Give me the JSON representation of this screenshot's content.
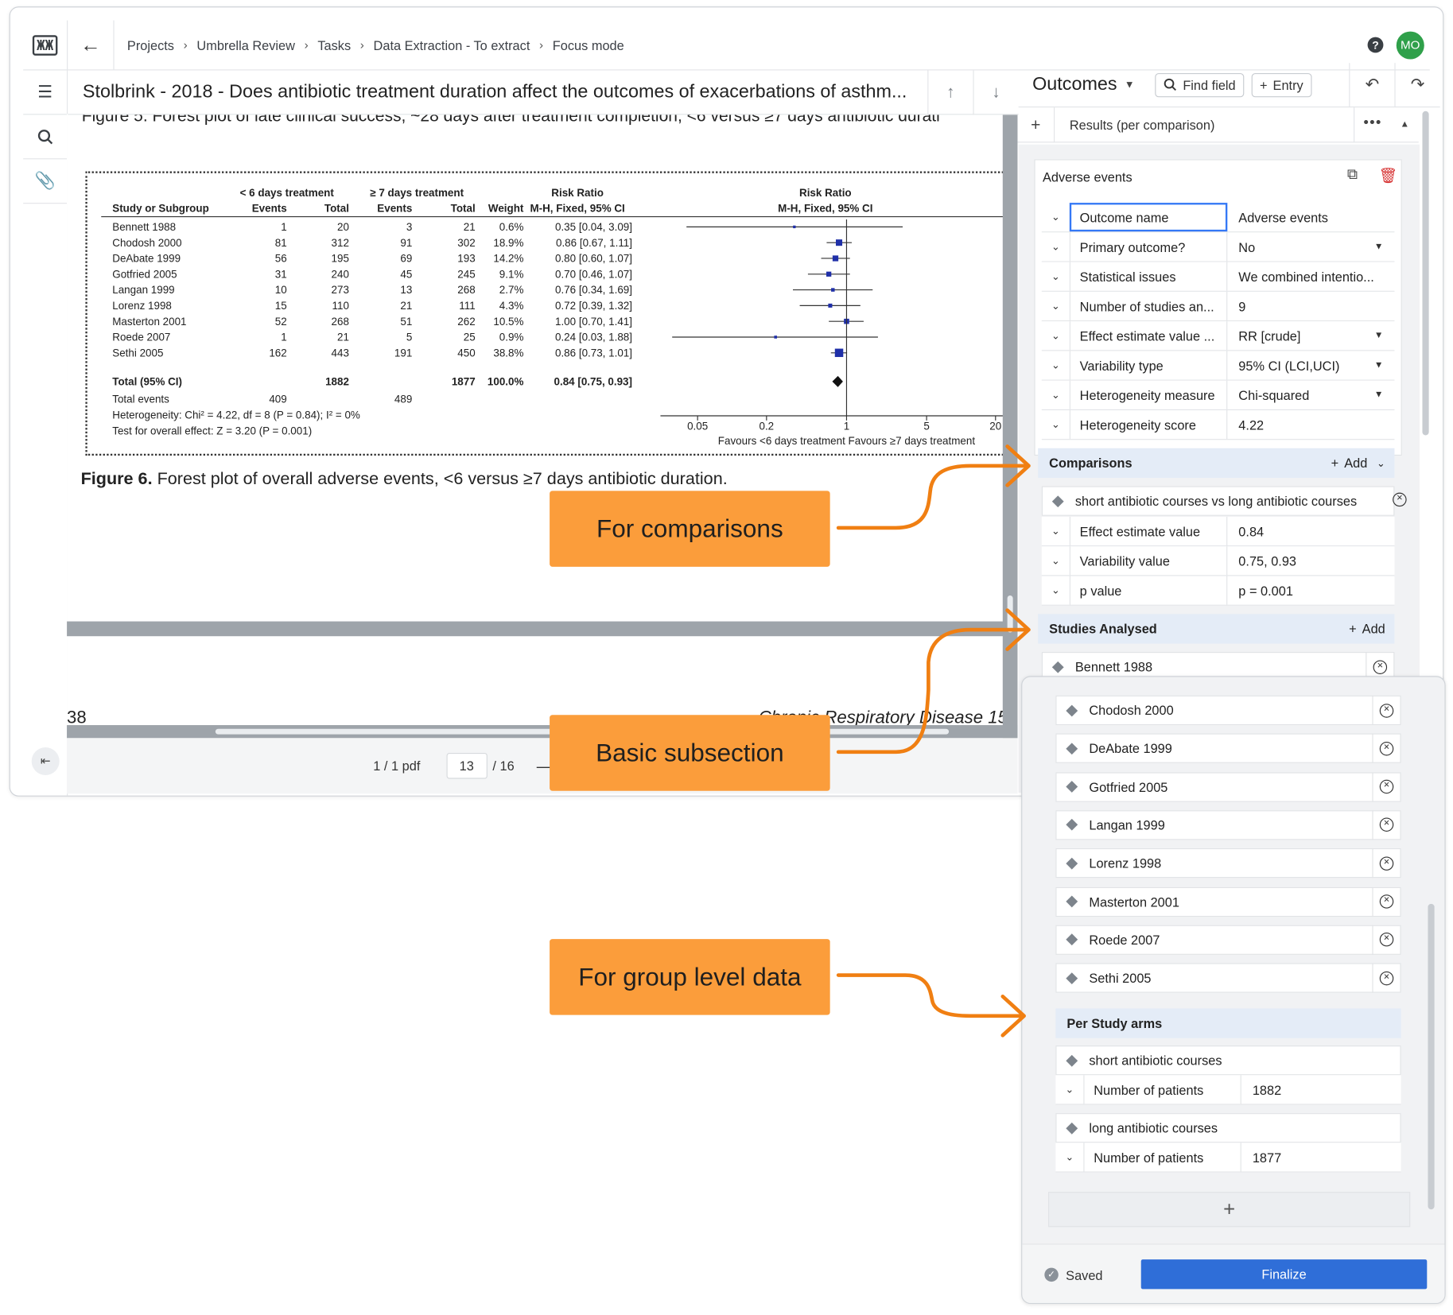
{
  "app": {
    "logo_text": "ЖЖ",
    "breadcrumb": [
      "Projects",
      "Umbrella Review",
      "Tasks",
      "Data Extraction - To extract",
      "Focus mode"
    ],
    "user_initials": "MO",
    "accent_color": "#2fa04a"
  },
  "document": {
    "title": "Stolbrink - 2018 - Does antibiotic treatment duration affect the outcomes of exacerbations of asthm...",
    "cut_line": "Figure 5. Forest plot of late clinical success, ~28 days after treatment completion, <6 versus ≥7 days antibiotic durati",
    "caption_bold": "Figure 6.",
    "caption_text": " Forest plot of overall adverse events, <6 versus ≥7 days antibiotic duration.",
    "page_number": "38",
    "journal": "Chronic Respiratory Disease 15(",
    "pdf_count": "1 / 1 pdf",
    "current_page": "13",
    "total_pages": "/ 16"
  },
  "chart_data": {
    "type": "table",
    "group_headers": [
      "< 6 days treatment",
      "≥ 7 days treatment",
      "Risk Ratio",
      "Risk Ratio"
    ],
    "columns": [
      "Study or Subgroup",
      "Events",
      "Total",
      "Events",
      "Total",
      "Weight",
      "M-H, Fixed, 95% CI",
      "M-H, Fixed, 95% CI"
    ],
    "rows": [
      {
        "study": "Bennett 1988",
        "e1": "1",
        "t1": "20",
        "e2": "3",
        "t2": "21",
        "weight": "0.6%",
        "ci": "0.35 [0.04, 3.09]",
        "rr": 0.35,
        "lo": 0.04,
        "hi": 3.09
      },
      {
        "study": "Chodosh 2000",
        "e1": "81",
        "t1": "312",
        "e2": "91",
        "t2": "302",
        "weight": "18.9%",
        "ci": "0.86 [0.67, 1.11]",
        "rr": 0.86,
        "lo": 0.67,
        "hi": 1.11
      },
      {
        "study": "DeAbate 1999",
        "e1": "56",
        "t1": "195",
        "e2": "69",
        "t2": "193",
        "weight": "14.2%",
        "ci": "0.80 [0.60, 1.07]",
        "rr": 0.8,
        "lo": 0.6,
        "hi": 1.07
      },
      {
        "study": "Gotfried 2005",
        "e1": "31",
        "t1": "240",
        "e2": "45",
        "t2": "245",
        "weight": "9.1%",
        "ci": "0.70 [0.46, 1.07]",
        "rr": 0.7,
        "lo": 0.46,
        "hi": 1.07
      },
      {
        "study": "Langan 1999",
        "e1": "10",
        "t1": "273",
        "e2": "13",
        "t2": "268",
        "weight": "2.7%",
        "ci": "0.76 [0.34, 1.69]",
        "rr": 0.76,
        "lo": 0.34,
        "hi": 1.69
      },
      {
        "study": "Lorenz 1998",
        "e1": "15",
        "t1": "110",
        "e2": "21",
        "t2": "111",
        "weight": "4.3%",
        "ci": "0.72 [0.39, 1.32]",
        "rr": 0.72,
        "lo": 0.39,
        "hi": 1.32
      },
      {
        "study": "Masterton 2001",
        "e1": "52",
        "t1": "268",
        "e2": "51",
        "t2": "262",
        "weight": "10.5%",
        "ci": "1.00 [0.70, 1.41]",
        "rr": 1.0,
        "lo": 0.7,
        "hi": 1.41
      },
      {
        "study": "Roede 2007",
        "e1": "1",
        "t1": "21",
        "e2": "5",
        "t2": "25",
        "weight": "0.9%",
        "ci": "0.24 [0.03, 1.88]",
        "rr": 0.24,
        "lo": 0.03,
        "hi": 1.88
      },
      {
        "study": "Sethi 2005",
        "e1": "162",
        "t1": "443",
        "e2": "191",
        "t2": "450",
        "weight": "38.8%",
        "ci": "0.86 [0.73, 1.01]",
        "rr": 0.86,
        "lo": 0.73,
        "hi": 1.01
      }
    ],
    "total_row": {
      "study": "Total (95% CI)",
      "t1": "1882",
      "t2": "1877",
      "weight": "100.0%",
      "ci": "0.84 [0.75, 0.93]",
      "rr": 0.84,
      "lo": 0.75,
      "hi": 0.93
    },
    "events_row": {
      "study": "Total events",
      "e1": "409",
      "e2": "489"
    },
    "heterogeneity": "Heterogeneity: Chi² = 4.22, df = 8 (P = 0.84); I² = 0%",
    "overall_effect": "Test for overall effect: Z = 3.20 (P = 0.001)",
    "x_ticks": [
      "0.05",
      "0.2",
      "1",
      "5",
      "20"
    ],
    "x_tick_values": [
      0.05,
      0.2,
      1,
      5,
      20
    ],
    "xlim": [
      0.03,
      30
    ],
    "x_scale": "log",
    "favours": "Favours <6 days treatment  Favours ≥7 days treatment",
    "marker_color": "#1f2fa8"
  },
  "fields_panel": {
    "header": "Outcomes",
    "find_field": "Find field",
    "entry": "Entry",
    "results_label": "Results (per comparison)",
    "card_title": "Adverse events",
    "fields": [
      {
        "name": "Outcome name",
        "value": "Adverse events",
        "dropdown": false
      },
      {
        "name": "Primary outcome?",
        "value": "No",
        "dropdown": true
      },
      {
        "name": "Statistical issues",
        "value": "We combined intentio...",
        "dropdown": false
      },
      {
        "name": "Number of studies an...",
        "value": "9",
        "dropdown": false
      },
      {
        "name": "Effect estimate value ...",
        "value": "RR [crude]",
        "dropdown": true
      },
      {
        "name": "Variability type",
        "value": "95% CI (LCI,UCI)",
        "dropdown": true
      },
      {
        "name": "Heterogeneity measure",
        "value": "Chi-squared",
        "dropdown": true
      },
      {
        "name": "Heterogeneity score",
        "value": "4.22",
        "dropdown": false
      }
    ],
    "comparisons": {
      "title": "Comparisons",
      "add": "Add",
      "item": "short antibiotic courses vs long antibiotic courses",
      "fields": [
        {
          "name": "Effect estimate value",
          "value": "0.84"
        },
        {
          "name": "Variability value",
          "value": "0.75, 0.93"
        },
        {
          "name": "p value",
          "value": "p = 0.001"
        }
      ]
    },
    "studies": {
      "title": "Studies Analysed",
      "add": "Add",
      "first": "Bennett 1988"
    }
  },
  "float_panel": {
    "studies": [
      "Chodosh 2000",
      "DeAbate 1999",
      "Gotfried 2005",
      "Langan 1999",
      "Lorenz 1998",
      "Masterton 2001",
      "Roede 2007",
      "Sethi 2005"
    ],
    "arms_title": "Per Study arms",
    "arms": [
      {
        "name": "short antibiotic courses",
        "field": "Number of patients",
        "value": "1882"
      },
      {
        "name": "long antibiotic courses",
        "field": "Number of patients",
        "value": "1877"
      }
    ],
    "saved": "Saved",
    "finalize": "Finalize",
    "finalize_color": "#2f6ed8"
  },
  "callouts": {
    "comparisons": "For comparisons",
    "basic": "Basic subsection",
    "group": "For group level data",
    "color": "#fb9d3b",
    "arrow_color": "#f07f12"
  }
}
